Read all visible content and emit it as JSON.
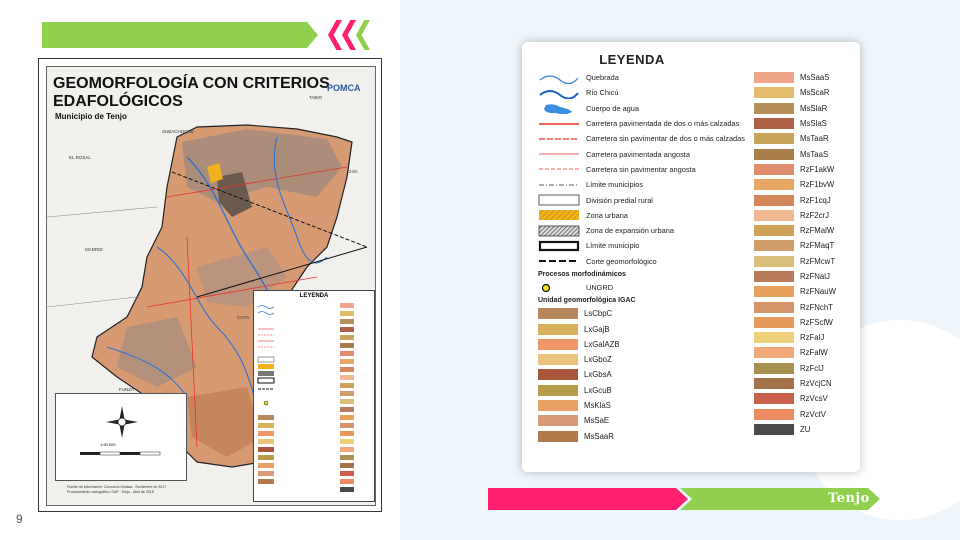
{
  "page": {
    "number": "9"
  },
  "brand": {
    "logo_text": "Tenjo",
    "pink": "#ff1f6e",
    "green": "#8fd14f"
  },
  "map": {
    "title_line1": "GEOMORFOLOGÍA CON CRITERIOS",
    "title_line2": "EDAFOLÓGICOS",
    "subtitle": "Municipio de Tenjo",
    "agency": "POMCA",
    "places": [
      "TABIO",
      "SUBACHOQUE",
      "EL ROSAL",
      "CHÍA",
      "MADRID",
      "COTA",
      "FUNZA"
    ],
    "mini_legend_title": "LEYENDA",
    "scale": "1:90.000",
    "source_line1": "Fuente de información: Consorcio Huitaca - Noviembre de 2017",
    "source_line2": "Procesamiento cartográfico: DAP - Tenjo - Abril de 2018"
  },
  "legend": {
    "title": "LEYENDA",
    "line_items": [
      {
        "label": "Quebrada",
        "symbol": "wave-thin",
        "color": "#3a7fd5"
      },
      {
        "label": "Río Chicú",
        "symbol": "wave-thick",
        "color": "#1a62c4"
      },
      {
        "label": "Cuerpo de agua",
        "symbol": "water-blob",
        "color": "#3a8ee0"
      },
      {
        "label": "Carretera pavimentada de dos o más calzadas",
        "symbol": "line-solid",
        "color": "#e8312a"
      },
      {
        "label": "Carretera sin pavimentar de dos o más calzadas",
        "symbol": "line-dash",
        "color": "#e8312a"
      },
      {
        "label": "Carretera pavimentada angosta",
        "symbol": "line-thin",
        "color": "#e86a5a"
      },
      {
        "label": "Carretera sin pavimentar angosta",
        "symbol": "line-thin-dash",
        "color": "#e86a5a"
      },
      {
        "label": "Límite municipios",
        "symbol": "line-dashdot",
        "color": "#555555"
      },
      {
        "label": "División predial rural",
        "symbol": "box-empty",
        "color": "#333333"
      },
      {
        "label": "Zona urbana",
        "symbol": "box-hatch-yellow",
        "color": "#f2b11f"
      },
      {
        "label": "Zona de expansión urbana",
        "symbol": "box-hatch-gray",
        "color": "#555555"
      },
      {
        "label": "Límite municipio",
        "symbol": "box-thick",
        "color": "#111111"
      },
      {
        "label": "Corte geomorfológico",
        "symbol": "line-bold-dash",
        "color": "#111111"
      }
    ],
    "process_section": "Procesos morfodinámicos",
    "process_item": {
      "label": "UNGRD",
      "symbol": "dot-yellow",
      "color": "#f5e11c"
    },
    "unit_section": "Unidad geomorfológica IGAC",
    "units_left": [
      {
        "label": "LsCbpC",
        "color": "#b5875a"
      },
      {
        "label": "LxGajB",
        "color": "#d8b25b"
      },
      {
        "label": "LxGalAZB",
        "color": "#f0946a"
      },
      {
        "label": "LxGboZ",
        "color": "#e8c27e"
      },
      {
        "label": "LxGbsA",
        "color": "#a9553a"
      },
      {
        "label": "LxGcuB",
        "color": "#b59a47"
      },
      {
        "label": "MsKlaS",
        "color": "#e8a064"
      },
      {
        "label": "MsSaE",
        "color": "#d99a78"
      },
      {
        "label": "MsSaaR",
        "color": "#b07a4c"
      }
    ],
    "units_right": [
      {
        "label": "MsSaaS",
        "color": "#f0a68a"
      },
      {
        "label": "MsScaR",
        "color": "#e2bc6a"
      },
      {
        "label": "MsSlaR",
        "color": "#b5905a"
      },
      {
        "label": "MsSlaS",
        "color": "#ad6248"
      },
      {
        "label": "MsTaaR",
        "color": "#c8a55c"
      },
      {
        "label": "MsTaaS",
        "color": "#a87e4a"
      },
      {
        "label": "RzF1akW",
        "color": "#e08d6e"
      },
      {
        "label": "RzF1bvW",
        "color": "#e8a865"
      },
      {
        "label": "RzF1cqJ",
        "color": "#d5875c"
      },
      {
        "label": "RzF2crJ",
        "color": "#f0b890"
      },
      {
        "label": "RzFMalW",
        "color": "#cfa258"
      },
      {
        "label": "RzFMaqT",
        "color": "#cf9d6a"
      },
      {
        "label": "RzFMcwT",
        "color": "#d8c07a"
      },
      {
        "label": "RzFNalJ",
        "color": "#b87b5c"
      },
      {
        "label": "RzFNauW",
        "color": "#e6a15a"
      },
      {
        "label": "RzFNchT",
        "color": "#d4956a"
      },
      {
        "label": "RzFScfW",
        "color": "#e39a5a"
      },
      {
        "label": "RzFalJ",
        "color": "#f0cf7a"
      },
      {
        "label": "RzFalW",
        "color": "#f0a878"
      },
      {
        "label": "RzFclJ",
        "color": "#a89050"
      },
      {
        "label": "RzVcjCN",
        "color": "#a37248"
      },
      {
        "label": "RzVcsV",
        "color": "#c8604a"
      },
      {
        "label": "RzVctV",
        "color": "#ec8c60"
      },
      {
        "label": "ZU",
        "color": "#4a4a4a"
      }
    ]
  }
}
